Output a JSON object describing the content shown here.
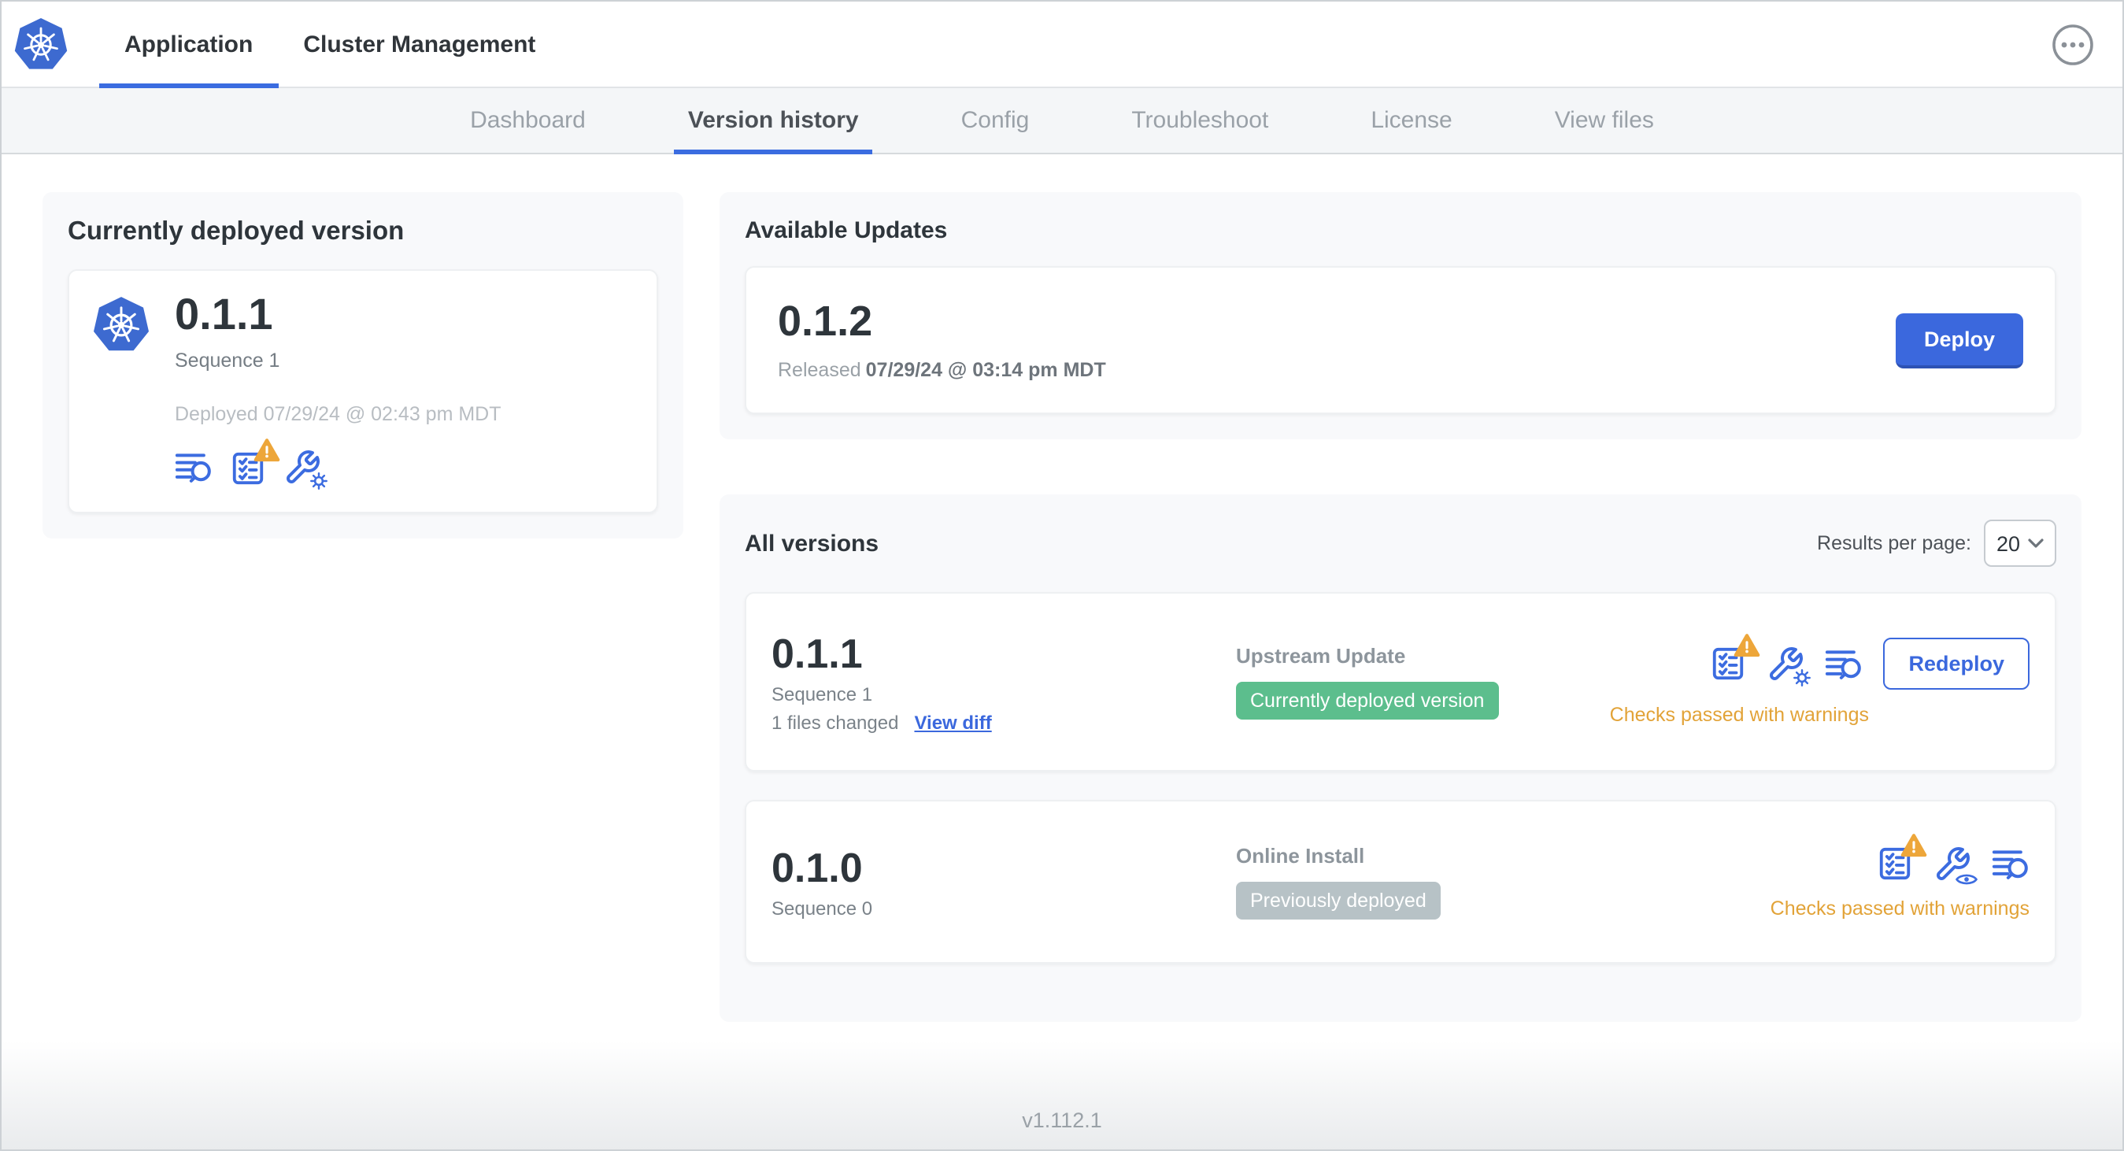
{
  "colors": {
    "accent_blue": "#3b68dd",
    "kubernetes_blue": "#3d6ad0",
    "badge_green": "#5cbe8d",
    "badge_gray": "#b7c2c6",
    "warning_orange": "#e2a338",
    "subnav_bg": "#f4f6f8",
    "card_bg": "#f8f9fb"
  },
  "topnav": {
    "logo_icon": "kubernetes-logo",
    "menu_icon": "ellipsis-icon",
    "tabs": [
      {
        "label": "Application",
        "active": true
      },
      {
        "label": "Cluster Management",
        "active": false
      }
    ]
  },
  "subnav": {
    "items": [
      {
        "label": "Dashboard",
        "active": false
      },
      {
        "label": "Version history",
        "active": true
      },
      {
        "label": "Config",
        "active": false
      },
      {
        "label": "Troubleshoot",
        "active": false
      },
      {
        "label": "License",
        "active": false
      },
      {
        "label": "View files",
        "active": false
      }
    ]
  },
  "current_version": {
    "title": "Currently deployed version",
    "version": "0.1.1",
    "sequence": "Sequence 1",
    "deployed": "Deployed 07/29/24 @ 02:43 pm MDT",
    "icons": [
      "diff-icon",
      "preflight-checks-warning-icon",
      "edit-config-icon"
    ]
  },
  "available_updates": {
    "title": "Available Updates",
    "version": "0.1.2",
    "released_label": "Released",
    "released_date": "07/29/24 @ 03:14 pm MDT",
    "deploy_label": "Deploy"
  },
  "all_versions": {
    "title": "All versions",
    "results_per_page_label": "Results per page:",
    "results_per_page_value": "20",
    "rows": [
      {
        "version": "0.1.1",
        "sequence": "Sequence 1",
        "files_changed": "1 files changed",
        "view_diff_label": "View diff",
        "source": "Upstream Update",
        "badge": {
          "label": "Currently deployed version",
          "color": "#5cbe8d"
        },
        "icons": [
          "preflight-checks-warning-icon",
          "edit-config-icon",
          "diff-icon"
        ],
        "status": "Checks passed with warnings",
        "action_label": "Redeploy"
      },
      {
        "version": "0.1.0",
        "sequence": "Sequence 0",
        "source": "Online Install",
        "badge": {
          "label": "Previously deployed",
          "color": "#b7c2c6"
        },
        "icons": [
          "preflight-checks-warning-icon",
          "view-config-icon",
          "diff-icon"
        ],
        "status": "Checks passed with warnings"
      }
    ]
  },
  "footer": {
    "version": "v1.112.1"
  }
}
